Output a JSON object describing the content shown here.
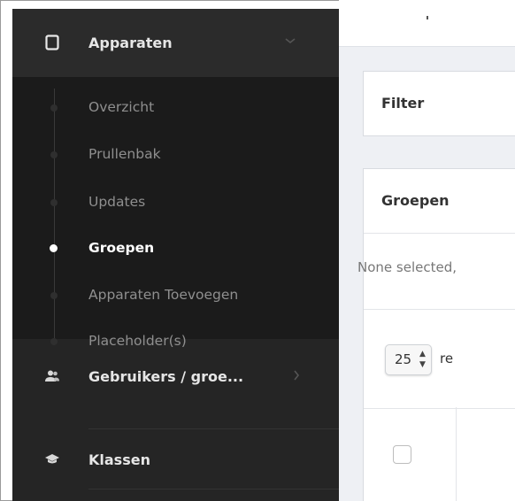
{
  "sidebar": {
    "section": {
      "label": "Apparaten",
      "icon": "tablet-icon",
      "chevron": "chevron-down-icon"
    },
    "sub_items": [
      {
        "label": "Overzicht",
        "active": false
      },
      {
        "label": "Prullenbak",
        "active": false
      },
      {
        "label": "Updates",
        "active": false
      },
      {
        "label": "Groepen",
        "active": true
      },
      {
        "label": "Apparaten Toevoegen",
        "active": false
      },
      {
        "label": "Placeholder(s)",
        "active": false
      }
    ],
    "users": {
      "label": "Gebruikers / groe...",
      "icon": "users-icon",
      "chevron": "chevron-right-icon"
    },
    "classes": {
      "label": "Klassen",
      "icon": "graduation-cap-icon"
    }
  },
  "main": {
    "filter_title": "Filter",
    "groups_title": "Groepen",
    "none_selected": "None selected,",
    "page_size": "25",
    "page_size_suffix": "re"
  },
  "colors": {
    "sidebar_bg": "#252525",
    "submenu_bg": "#1b1b1b",
    "content_bg": "#eef0f4",
    "panel_bg": "#ffffff"
  }
}
